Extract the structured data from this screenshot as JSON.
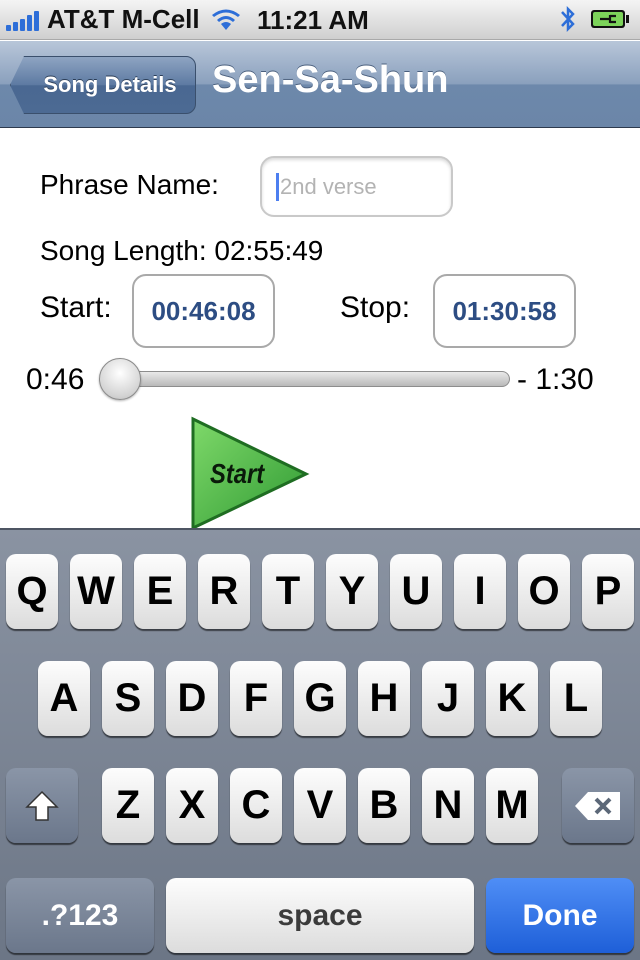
{
  "status_bar": {
    "carrier": "AT&T M-Cell",
    "time": "11:21 AM",
    "signal_bars": 5
  },
  "nav": {
    "back_label": "Song Details",
    "title": "Sen-Sa-Shun"
  },
  "form": {
    "phrase_label": "Phrase Name:",
    "phrase_placeholder": "2nd verse",
    "phrase_value": "",
    "song_length_label": "Song Length: 02:55:49",
    "start_label": "Start:",
    "start_value": "00:46:08",
    "stop_label": "Stop:",
    "stop_value": "01:30:58"
  },
  "slider": {
    "min_label": "0:46",
    "max_label": "- 1:30",
    "value_fraction": 0.0
  },
  "start_button": {
    "label": "Start"
  },
  "keyboard": {
    "row1": [
      "Q",
      "W",
      "E",
      "R",
      "T",
      "Y",
      "U",
      "I",
      "O",
      "P"
    ],
    "row2": [
      "A",
      "S",
      "D",
      "F",
      "G",
      "H",
      "J",
      "K",
      "L"
    ],
    "row3": [
      "Z",
      "X",
      "C",
      "V",
      "B",
      "N",
      "M"
    ],
    "numbers_label": ".?123",
    "space_label": "space",
    "done_label": "Done"
  },
  "colors": {
    "accent_blue": "#2d4d83",
    "nav_bar": "#7f97b7",
    "done_blue": "#2a6be0",
    "start_green": "#4cb848"
  }
}
